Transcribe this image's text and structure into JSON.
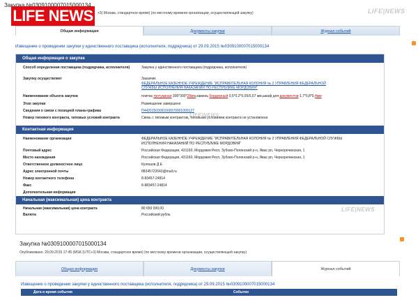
{
  "top": {
    "title": "Закупка №0309100007015000134",
    "logo": "LIFE NEWS",
    "subtitle": "+3) Москва, стандартное время) (по местному времени организации, осуществляющей закупку)",
    "watermark": "LIFE|NEWS"
  },
  "tabs_top": [
    {
      "label": "Общая информация"
    },
    {
      "label": "Документы закупки"
    },
    {
      "label": "Журнал событий"
    }
  ],
  "notice": "Извещение о проведении закупки у единственного поставщика (исполнителя, подрядчика) от 29.09.2015 №0309100007015000134",
  "section_general": {
    "title": "Общая информация о закупке",
    "rows": [
      {
        "k": "Способ определения поставщика (подрядчика, исполнителя)",
        "v": "Закупка у единственного поставщика (подрядчика, исполнителя)"
      },
      {
        "k": "Закупку осуществляет",
        "v1": "Заказчик",
        "v2": "ФЕДЕРАЛЬНОЕ КАЗЕННОЕ УЧРЕЖДЕНИЕ \"ИСПРАВИТЕЛЬНАЯ КОЛОНИЯ № 2 УПРАВЛЕНИЯ ФЕДЕРАЛЬНОЙ СЛУЖБЫ ИСПОЛНЕНИЯ НАКАЗАНИЙ ПО РЕСПУБЛИКЕ МОРДОВИЯ\""
      },
      {
        "k": "Наименование объекта закупки",
        "p1": "плитка ",
        "h1": "тротуарная",
        "p2": " 300*300*",
        "h2": "28мм",
        "p3": ",камень ",
        "h3": "бордюрный",
        "p4": " 0,5*0,2*0,05/0,07 мм,шкаф для ",
        "h4": "документов",
        "p5": " 1,7*0,8*0,",
        "h5": "4мм"
      },
      {
        "k": "Этап закупки",
        "v": "Размещение завершено"
      },
      {
        "k": "Сведения о связи с позицией плана-графика",
        "v": "П44201503091000070001000127"
      },
      {
        "k": "Номер типового контракта, типовых условий контракта",
        "v": "Связь с типовым контрактом, типовыми условиями контракта не установлена"
      }
    ]
  },
  "section_contact": {
    "title": "Контактная информация",
    "rows": [
      {
        "k": "Наименование организации",
        "v": "ФЕДЕРАЛЬНОЕ КАЗЕННОЕ УЧРЕЖДЕНИЕ \"ИСПРАВИТЕЛЬНАЯ КОЛОНИЯ № 2 УПРАВЛЕНИЯ ФЕДЕРАЛЬНОЙ СЛУЖБЫ ИСПОЛНЕНИЯ НАКАЗАНИЙ ПО РЕСПУБЛИКЕ МОРДОВИЯ\""
      },
      {
        "k": "Почтовый адрес",
        "v": "Российская Федерация, 431160, Мордовия Респ, Зубово-Полянский р-н, Явас рп, Черноречинская, 1"
      },
      {
        "k": "Место нахождения",
        "v": "Российская Федерация, 431160, Мордовия Респ, Зубово-Полянский р-н, Явас рп, Черноречинская, 1"
      },
      {
        "k": "Ответственное должностное лицо",
        "v": "Кулешов Д Е"
      },
      {
        "k": "Адрес электронной почты",
        "v": "88345722643@mail.ru"
      },
      {
        "k": "Номер контактного телефона",
        "v": "8-83457-24814"
      },
      {
        "k": "Факс",
        "v": "8-883457-24814"
      },
      {
        "k": "Дополнительная информация",
        "v": ""
      }
    ]
  },
  "section_price": {
    "title": "Начальная (максимальная) цена контракта",
    "rows": [
      {
        "k": "Начальная (максимальная) цена контракта",
        "v": "80 650 000,00"
      },
      {
        "k": "Валюта",
        "v": "Российский рубль"
      }
    ]
  },
  "bottom": {
    "title": "Закупка №0309100007015000134",
    "subtitle": "Опубликовано: 29.09.2015 17:45 (MSK (UTC+3) Москва, стандартное время) (по местному времени организации, осуществляющей закупку)",
    "tabs": [
      {
        "label": "Общая информация"
      },
      {
        "label": "Документы закупки"
      },
      {
        "label": "Журнал событий"
      }
    ],
    "notice": "Извещение о проведении закупки у единственного поставщика (исполнителя, подрядчика) от 29.09.2015 №0309100007015000134",
    "col_date": "Дата и время события",
    "col_event": "Событие"
  }
}
